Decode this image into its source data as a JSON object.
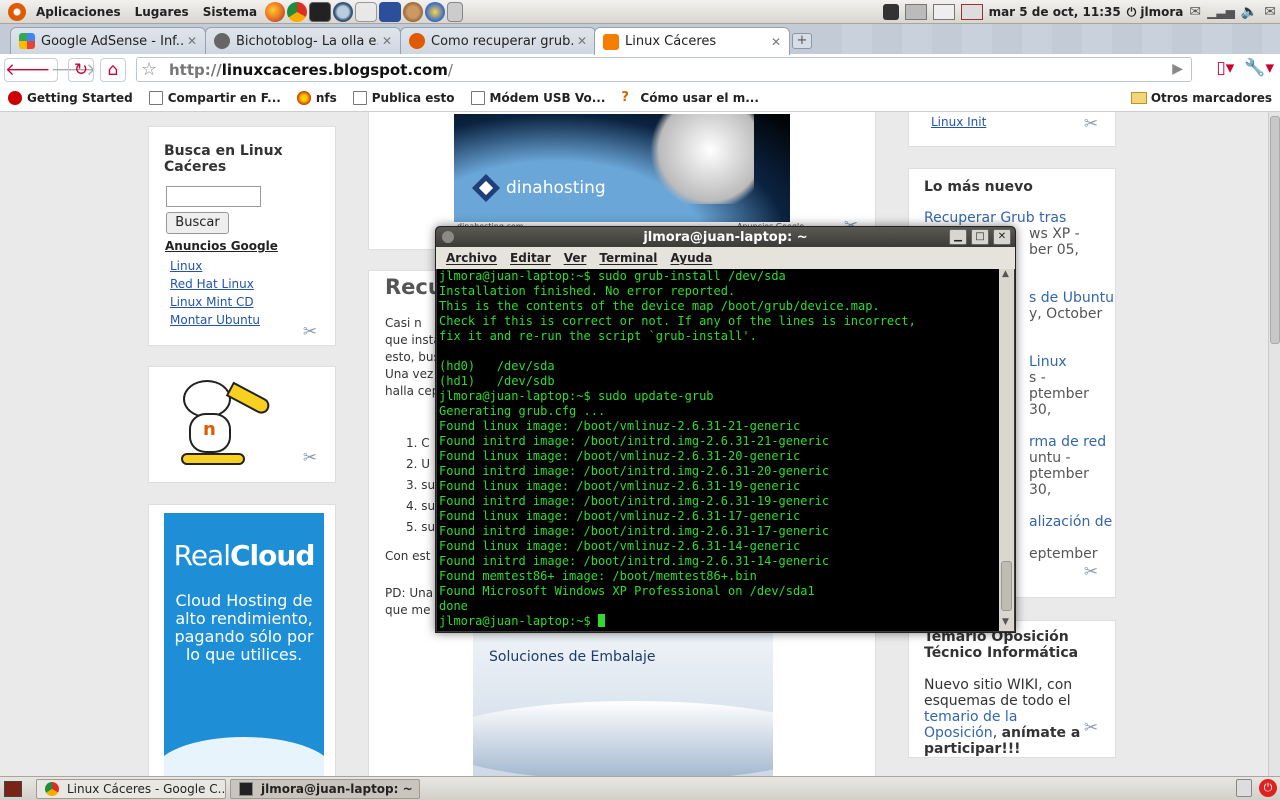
{
  "top_panel": {
    "menus": [
      "Aplicaciones",
      "Lugares",
      "Sistema"
    ],
    "clock": "mar  5 de oct, 11:35",
    "user": "jlmora"
  },
  "browser": {
    "tabs": [
      {
        "title": "Google AdSense - Inf...",
        "active": false
      },
      {
        "title": "Bichotoblog- La olla e...",
        "active": false
      },
      {
        "title": "Como recuperar grub...",
        "active": false
      },
      {
        "title": "Linux Cáceres",
        "active": true
      }
    ],
    "url": {
      "scheme": "http://",
      "host": "linuxcaceres.blogspot.com",
      "path": "/"
    },
    "bookmarks": [
      "Getting Started",
      "Compartir en F...",
      "nfs",
      "Publica esto",
      "Módem USB Vo...",
      "Cómo usar el m..."
    ],
    "other_bookmarks": "Otros marcadores"
  },
  "page": {
    "search_widget": {
      "title": "Busca en Linux Caćeres",
      "button": "Buscar",
      "ads_title": "Anuncios Google",
      "ads": [
        "Linux",
        "Red Hat Linux",
        "Linux Mint CD",
        "Montar Ubuntu"
      ]
    },
    "dinahosting": {
      "brand": "dinahosting",
      "footer_left": "dinahosting.com",
      "footer_right": "Anuncios Google"
    },
    "post": {
      "title_visible": "Recu",
      "para1": [
        "Casi n",
        "que insta",
        "esto, bus",
        "Una vez",
        "halla cep"
      ],
      "list": [
        "1.  C",
        "2.  U",
        "3.  su",
        "4.  su",
        "5.  su"
      ],
      "para2": "Con est",
      "para3": [
        "PD: Una",
        "que me"
      ]
    },
    "realcloud": {
      "brand_light": "Real",
      "brand_bold": "Cloud",
      "tagline": "Cloud Hosting de alto rendimiento, pagando sólo por lo que utilices."
    },
    "embalaje": {
      "text": "Soluciones de Embalaje"
    },
    "right_column": {
      "top_link": "Linux Init",
      "latest_title": "Lo más nuevo",
      "latest_items": [
        {
          "link": "Recuperar Grub tras",
          "rest": [
            "ws XP -",
            "ber 05,"
          ]
        },
        {
          "link": "s de Ubuntu",
          "rest": [
            "y, October"
          ]
        },
        {
          "link": "Linux",
          "rest": [
            "s -",
            "ptember 30,"
          ]
        },
        {
          "link": "rma de red",
          "rest": [
            "untu -",
            "ptember 30,"
          ]
        },
        {
          "link": "alización de",
          "rest": [
            "eptember"
          ]
        }
      ],
      "temario_title": "Temario Oposición Técnico Informática",
      "temario_text1": "Nuevo sitio WIKI, con esquemas de todo el",
      "temario_link": "temario de la Oposición",
      "temario_text2": "anímate a participar!!!"
    }
  },
  "terminal": {
    "title": "jlmora@juan-laptop: ~",
    "menu": [
      "Archivo",
      "Editar",
      "Ver",
      "Terminal",
      "Ayuda"
    ],
    "lines": [
      "jlmora@juan-laptop:~$ sudo grub-install /dev/sda",
      "Installation finished. No error reported.",
      "This is the contents of the device map /boot/grub/device.map.",
      "Check if this is correct or not. If any of the lines is incorrect,",
      "fix it and re-run the script `grub-install'.",
      "",
      "(hd0)   /dev/sda",
      "(hd1)   /dev/sdb",
      "jlmora@juan-laptop:~$ sudo update-grub",
      "Generating grub.cfg ...",
      "Found linux image: /boot/vmlinuz-2.6.31-21-generic",
      "Found initrd image: /boot/initrd.img-2.6.31-21-generic",
      "Found linux image: /boot/vmlinuz-2.6.31-20-generic",
      "Found initrd image: /boot/initrd.img-2.6.31-20-generic",
      "Found linux image: /boot/vmlinuz-2.6.31-19-generic",
      "Found initrd image: /boot/initrd.img-2.6.31-19-generic",
      "Found linux image: /boot/vmlinuz-2.6.31-17-generic",
      "Found initrd image: /boot/initrd.img-2.6.31-17-generic",
      "Found linux image: /boot/vmlinuz-2.6.31-14-generic",
      "Found initrd image: /boot/initrd.img-2.6.31-14-generic",
      "Found memtest86+ image: /boot/memtest86+.bin",
      "Found Microsoft Windows XP Professional on /dev/sda1",
      "done"
    ],
    "prompt": "jlmora@juan-laptop:~$ "
  },
  "taskbar": {
    "items": [
      {
        "label": "Linux Cáceres - Google C...",
        "active": false
      },
      {
        "label": "jlmora@juan-laptop: ~",
        "active": true
      }
    ]
  },
  "colors": {
    "terminal_text": "#2edb2e",
    "link": "#2255aa",
    "realcloud_bg": "#1e8fd6"
  }
}
